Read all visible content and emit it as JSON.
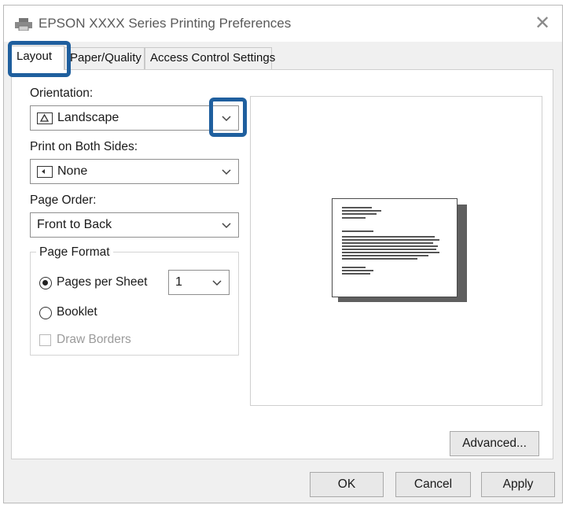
{
  "window": {
    "title": "EPSON XXXX Series  Printing Preferences",
    "close_glyph": "✕"
  },
  "tabs": [
    {
      "label": "Layout"
    },
    {
      "label": "Paper/Quality"
    },
    {
      "label": "Access Control Settings"
    }
  ],
  "layout": {
    "orientation": {
      "label": "Orientation:",
      "value": "Landscape",
      "icon": "landscape-page-icon"
    },
    "print_both_sides": {
      "label": "Print on Both Sides:",
      "value": "None",
      "icon": "duplex-icon"
    },
    "page_order": {
      "label": "Page Order:",
      "value": "Front to Back"
    },
    "page_format": {
      "title": "Page Format",
      "pages_per_sheet": {
        "label": "Pages per Sheet",
        "value": "1",
        "checked": true
      },
      "booklet": {
        "label": "Booklet",
        "checked": false
      },
      "draw_borders": {
        "label": "Draw Borders",
        "checked": false,
        "disabled": true
      }
    }
  },
  "buttons": {
    "advanced": "Advanced...",
    "ok": "OK",
    "cancel": "Cancel",
    "apply": "Apply"
  },
  "colors": {
    "highlight": "#1f5f9e",
    "window_bg": "#f0f0f0"
  }
}
